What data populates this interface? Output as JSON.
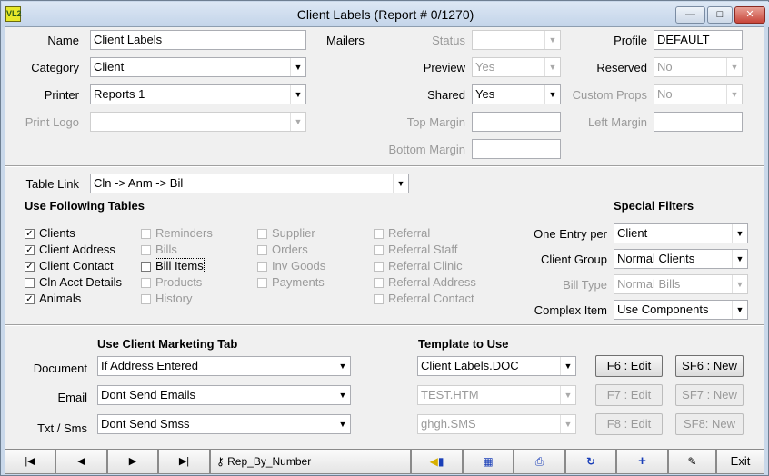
{
  "window": {
    "icon_text": "VL2",
    "title": "Client Labels (Report # 0/1270)",
    "minimize": "—",
    "maximize": "□",
    "close": "✕"
  },
  "top": {
    "name_label": "Name",
    "name_value": "Client Labels",
    "category_label": "Category",
    "category_value": "Client",
    "printer_label": "Printer",
    "printer_value": "Reports 1",
    "print_logo_label": "Print Logo",
    "print_logo_value": "",
    "mailers_label": "Mailers",
    "status_label": "Status",
    "status_value": "",
    "preview_label": "Preview",
    "preview_value": "Yes",
    "shared_label": "Shared",
    "shared_value": "Yes",
    "top_margin_label": "Top Margin",
    "top_margin_value": "",
    "bottom_margin_label": "Bottom Margin",
    "bottom_margin_value": "",
    "profile_label": "Profile",
    "profile_value": "DEFAULT",
    "reserved_label": "Reserved",
    "reserved_value": "No",
    "custom_props_label": "Custom Props",
    "custom_props_value": "No",
    "left_margin_label": "Left Margin",
    "left_margin_value": ""
  },
  "middle": {
    "table_link_label": "Table Link",
    "table_link_value": "Cln -> Anm -> Bil",
    "use_tables_heading": "Use Following Tables",
    "special_filters_heading": "Special Filters",
    "tables": [
      {
        "label": "Clients",
        "checked": true,
        "enabled": true
      },
      {
        "label": "Client Address",
        "checked": true,
        "enabled": true
      },
      {
        "label": "Client Contact",
        "checked": true,
        "enabled": true
      },
      {
        "label": "Cln Acct Details",
        "checked": false,
        "enabled": true
      },
      {
        "label": "Animals",
        "checked": true,
        "enabled": true
      },
      {
        "label": "Reminders",
        "checked": false,
        "enabled": false
      },
      {
        "label": "Bills",
        "checked": false,
        "enabled": false
      },
      {
        "label": "Bill Items",
        "checked": false,
        "enabled": true
      },
      {
        "label": "Products",
        "checked": false,
        "enabled": false
      },
      {
        "label": "History",
        "checked": false,
        "enabled": false
      },
      {
        "label": "Supplier",
        "checked": false,
        "enabled": false
      },
      {
        "label": "Orders",
        "checked": false,
        "enabled": false
      },
      {
        "label": "Inv Goods",
        "checked": false,
        "enabled": false
      },
      {
        "label": "Payments",
        "checked": false,
        "enabled": false
      },
      {
        "label": "Referral",
        "checked": false,
        "enabled": false
      },
      {
        "label": "Referral Staff",
        "checked": false,
        "enabled": false
      },
      {
        "label": "Referral Clinic",
        "checked": false,
        "enabled": false
      },
      {
        "label": "Referral Address",
        "checked": false,
        "enabled": false
      },
      {
        "label": "Referral Contact",
        "checked": false,
        "enabled": false
      }
    ],
    "one_entry_label": "One Entry per",
    "one_entry_value": "Client",
    "client_group_label": "Client Group",
    "client_group_value": "Normal Clients",
    "bill_type_label": "Bill Type",
    "bill_type_value": "Normal Bills",
    "complex_item_label": "Complex Item",
    "complex_item_value": "Use Components"
  },
  "bottom": {
    "marketing_heading": "Use Client Marketing Tab",
    "template_heading": "Template to Use",
    "document_label": "Document",
    "document_value": "If Address Entered",
    "email_label": "Email",
    "email_value": "Dont Send Emails",
    "sms_label": "Txt / Sms",
    "sms_value": "Dont Send Smss",
    "doc_template": "Client Labels.DOC",
    "email_template": "TEST.HTM",
    "sms_template": "ghgh.SMS",
    "f6_edit": "F6 : Edit",
    "sf6_new": "SF6 : New",
    "f7_edit": "F7 : Edit",
    "sf7_new": "SF7 : New",
    "f8_edit": "F8 : Edit",
    "sf8_new": "SF8: New"
  },
  "navbar": {
    "first": "|◀",
    "prev": "◀",
    "next": "▶",
    "last": "▶|",
    "sort_key_icon": "key-icon",
    "sort_value": "Rep_By_Number",
    "exit": "Exit"
  },
  "colors": {
    "frame": "#c9d8ea",
    "panel": "#f0f0f0",
    "disabled_text": "#9a9a9a",
    "close": "#c8453a"
  }
}
